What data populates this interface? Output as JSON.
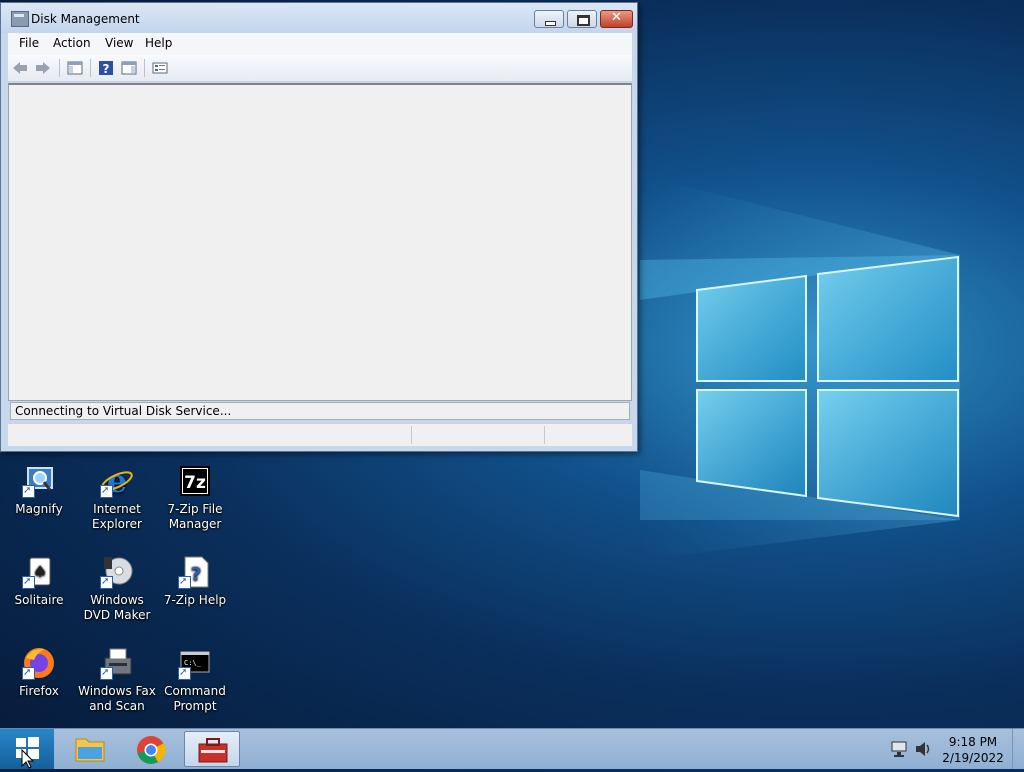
{
  "window": {
    "title": "Disk Management",
    "menu": [
      "File",
      "Action",
      "View",
      "Help"
    ],
    "status_text": "Connecting to Virtual Disk Service..."
  },
  "desktop_icons": [
    {
      "label": "Magnify",
      "icon": "magnifier-icon"
    },
    {
      "label": "Internet Explorer",
      "icon": "internet-explorer-icon"
    },
    {
      "label": "7-Zip File Manager",
      "icon": "7zip-icon"
    },
    {
      "label": "Solitaire",
      "icon": "cards-icon"
    },
    {
      "label": "Windows DVD Maker",
      "icon": "dvd-disc-icon"
    },
    {
      "label": "7-Zip Help",
      "icon": "help-document-icon"
    },
    {
      "label": "Firefox",
      "icon": "firefox-icon"
    },
    {
      "label": "Windows Fax and Scan",
      "icon": "fax-scanner-icon"
    },
    {
      "label": "Command Prompt",
      "icon": "terminal-icon"
    }
  ],
  "taskbar": {
    "apps": [
      "file-explorer-icon",
      "chrome-icon",
      "disk-management-icon"
    ],
    "time": "9:18 PM",
    "date": "2/19/2022"
  },
  "colors": {
    "desktop_blue": "#11508a",
    "logo_glow": "#7fdcff",
    "close_red": "#c2402a"
  }
}
